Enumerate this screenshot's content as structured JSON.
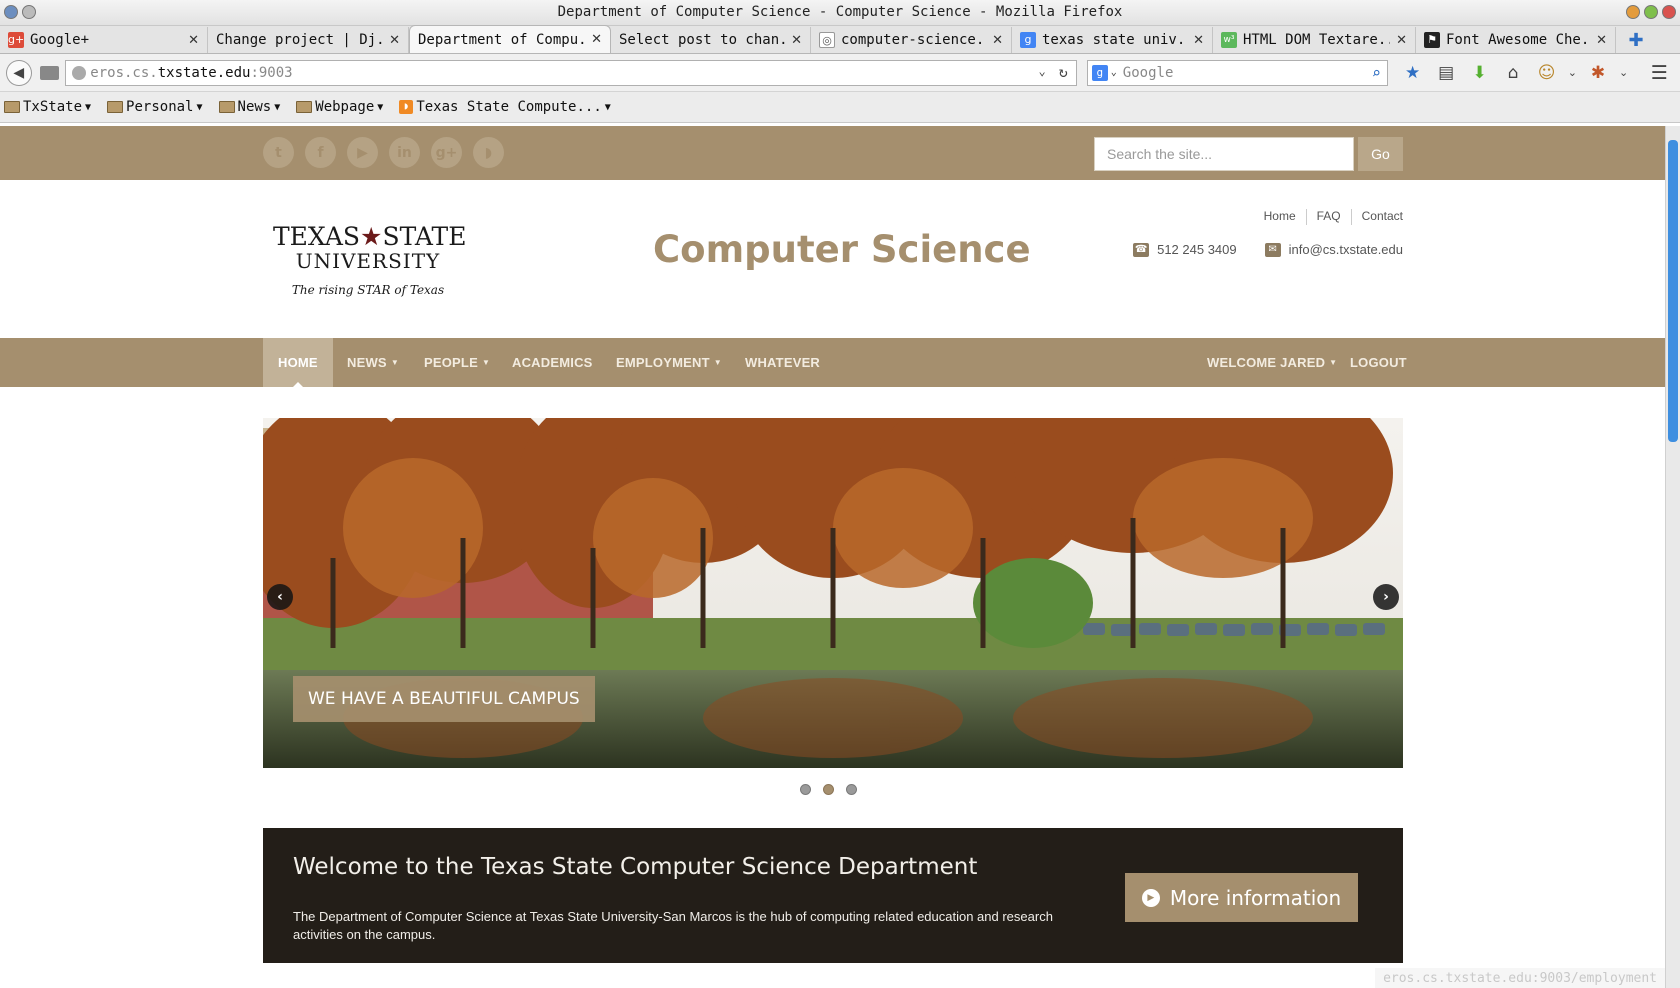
{
  "window": {
    "title": "Department of Computer Science - Computer Science - Mozilla Firefox"
  },
  "tabs": [
    {
      "label": "Google+",
      "favicon": "google-plus",
      "color": "#dd4b39",
      "glyph": "g"
    },
    {
      "label": "Change project | Dj...",
      "favicon": "none",
      "color": "",
      "glyph": ""
    },
    {
      "label": "Department of Compu...",
      "favicon": "none",
      "color": "",
      "glyph": "",
      "active": true
    },
    {
      "label": "Select post to chan...",
      "favicon": "none",
      "color": "",
      "glyph": ""
    },
    {
      "label": "computer-science...",
      "favicon": "github-cat",
      "color": "#777777",
      "glyph": "◎"
    },
    {
      "label": "texas state univ...",
      "favicon": "google",
      "color": "#4285f4",
      "glyph": "g"
    },
    {
      "label": "HTML DOM Textare...",
      "favicon": "w3schools",
      "color": "#5cb85c",
      "glyph": "w³"
    },
    {
      "label": "Font Awesome Che...",
      "favicon": "font-awesome",
      "color": "#222222",
      "glyph": "⚑"
    }
  ],
  "navbar": {
    "url_prefix": "eros.cs.",
    "url_host": "txstate.edu",
    "url_suffix": ":9003",
    "search_placeholder": "Google"
  },
  "bookmarks": [
    {
      "label": "TxState",
      "type": "folder"
    },
    {
      "label": "Personal",
      "type": "folder"
    },
    {
      "label": "News",
      "type": "folder"
    },
    {
      "label": "Webpage",
      "type": "folder"
    },
    {
      "label": "Texas State Compute...",
      "type": "rss"
    }
  ],
  "site": {
    "search_placeholder": "Search the site...",
    "go_label": "Go",
    "social": [
      "twitter",
      "facebook",
      "youtube",
      "linkedin",
      "google-plus",
      "rss"
    ],
    "logo": {
      "line1_a": "TEXAS",
      "line1_b": "STATE",
      "line2": "UNIVERSITY",
      "tagline": "The rising STAR of Texas"
    },
    "title": "Computer Science",
    "util_links": [
      "Home",
      "FAQ",
      "Contact"
    ],
    "phone": "512 245 3409",
    "email": "info@cs.txstate.edu",
    "nav": {
      "home": "HOME",
      "news": "NEWS",
      "people": "PEOPLE",
      "academics": "ACADEMICS",
      "employment": "EMPLOYMENT",
      "whatever": "WHATEVER",
      "welcome": "WELCOME JARED",
      "logout": "LOGOUT"
    },
    "slider": {
      "caption": "WE HAVE A BEAUTIFUL CAMPUS",
      "slide_count": 3,
      "active_slide": 2
    },
    "welcome": {
      "heading": "Welcome to the Texas State Computer Science Department",
      "body": "The Department of Computer Science at Texas State University-San Marcos is the hub of computing related education and research activities on the campus.",
      "button": "More information"
    },
    "status_url": "eros.cs.txstate.edu:9003/employment"
  },
  "colors": {
    "brand_gold": "#a58f6e",
    "brand_dark": "#231e18",
    "scroll_thumb": "#3e8fe0"
  }
}
